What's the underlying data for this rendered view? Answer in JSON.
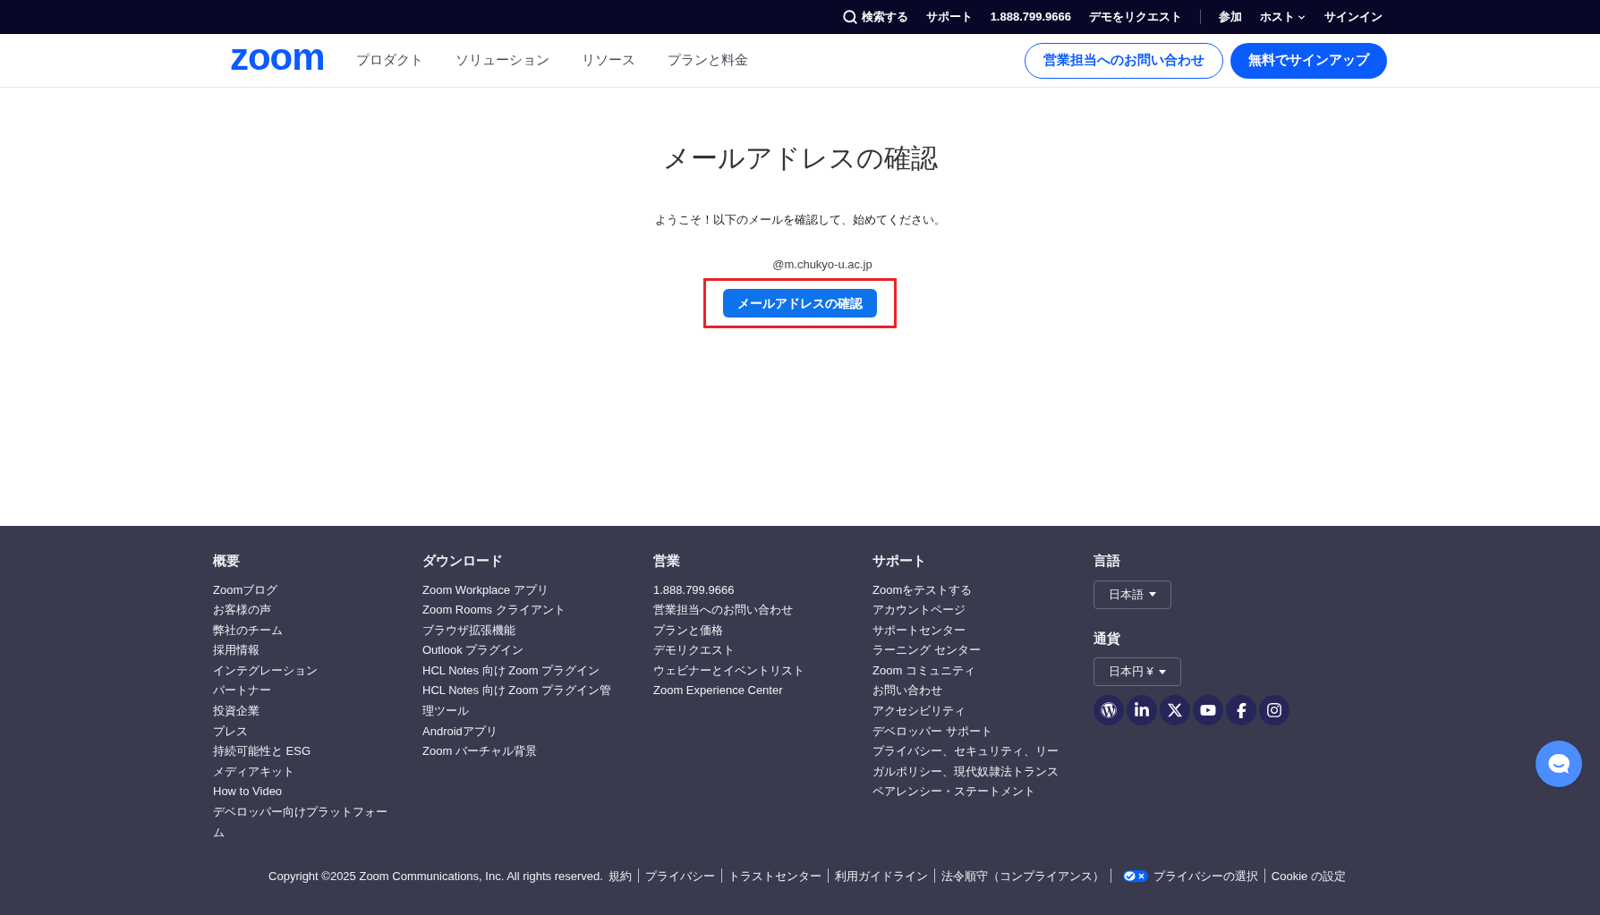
{
  "top_bar": {
    "search": "検索する",
    "links": [
      {
        "label": "サポート",
        "kind": "link"
      },
      {
        "label": "1.888.799.9666",
        "kind": "link"
      },
      {
        "label": "デモをリクエスト",
        "kind": "link"
      },
      {
        "label": "参加",
        "kind": "link"
      },
      {
        "label": "ホスト",
        "kind": "menu"
      },
      {
        "label": "サインイン",
        "kind": "link"
      }
    ]
  },
  "nav": {
    "logo": "zoom",
    "items": [
      "プロダクト",
      "ソリューション",
      "リソース",
      "プランと料金"
    ],
    "buttons": [
      {
        "label": "営業担当へのお問い合わせ",
        "kind": "outline"
      },
      {
        "label": "無料でサインアップ",
        "kind": "primary"
      }
    ]
  },
  "main": {
    "title": "メールアドレスの確認",
    "message": "ようこそ！以下のメールを確認して、始めてください。",
    "email": "@m.chukyo-u.ac.jp",
    "button": "メールアドレスの確認",
    "highlighted": true
  },
  "footer": {
    "columns": [
      {
        "heading": "概要",
        "items": [
          "Zoomブログ",
          "お客様の声",
          "弊社のチーム",
          "採用情報",
          "インテグレーション",
          "パートナー",
          "投資企業",
          "プレス",
          "持続可能性と ESG",
          "メディアキット",
          "How to Video",
          "デベロッパー向けプラットフォーム"
        ]
      },
      {
        "heading": "ダウンロード",
        "items": [
          "Zoom Workplace アプリ",
          "Zoom Rooms クライアント",
          "ブラウザ拡張機能",
          "Outlook プラグイン",
          "HCL Notes 向け Zoom プラグイン",
          "HCL Notes 向け Zoom プラグイン管理ツール",
          "Androidアプリ",
          "Zoom バーチャル背景"
        ]
      },
      {
        "heading": "営業",
        "items": [
          "1.888.799.9666",
          "営業担当へのお問い合わせ",
          "プランと価格",
          "デモリクエスト",
          "ウェビナーとイベントリスト",
          "Zoom Experience Center"
        ]
      },
      {
        "heading": "サポート",
        "items": [
          "Zoomをテストする",
          "アカウントページ",
          "サポートセンター",
          "ラーニング センター",
          "Zoom コミュニティ",
          "お問い合わせ",
          "アクセシビリティ",
          "デベロッパー サポート",
          "プライバシー、セキュリティ、リーガルポリシー、現代奴隷法トランスペアレンシー・ステートメント"
        ]
      }
    ],
    "language": {
      "heading": "言語",
      "value": "日本語"
    },
    "currency": {
      "heading": "通貨",
      "value": "日本円 ¥"
    },
    "bottom": {
      "copyright": "Copyright ©2025 Zoom Communications, Inc. All rights reserved.",
      "links": [
        {
          "label": "規約",
          "kind": "link"
        },
        {
          "label": "プライバシー",
          "kind": "link"
        },
        {
          "label": "トラストセンター",
          "kind": "link"
        },
        {
          "label": "利用ガイドライン",
          "kind": "link"
        },
        {
          "label": "法令順守（コンプライアンス）",
          "kind": "link"
        },
        {
          "label": "プライバシーの選択",
          "kind": "privacy-choice"
        },
        {
          "label": "Cookie の設定",
          "kind": "link"
        }
      ]
    }
  }
}
